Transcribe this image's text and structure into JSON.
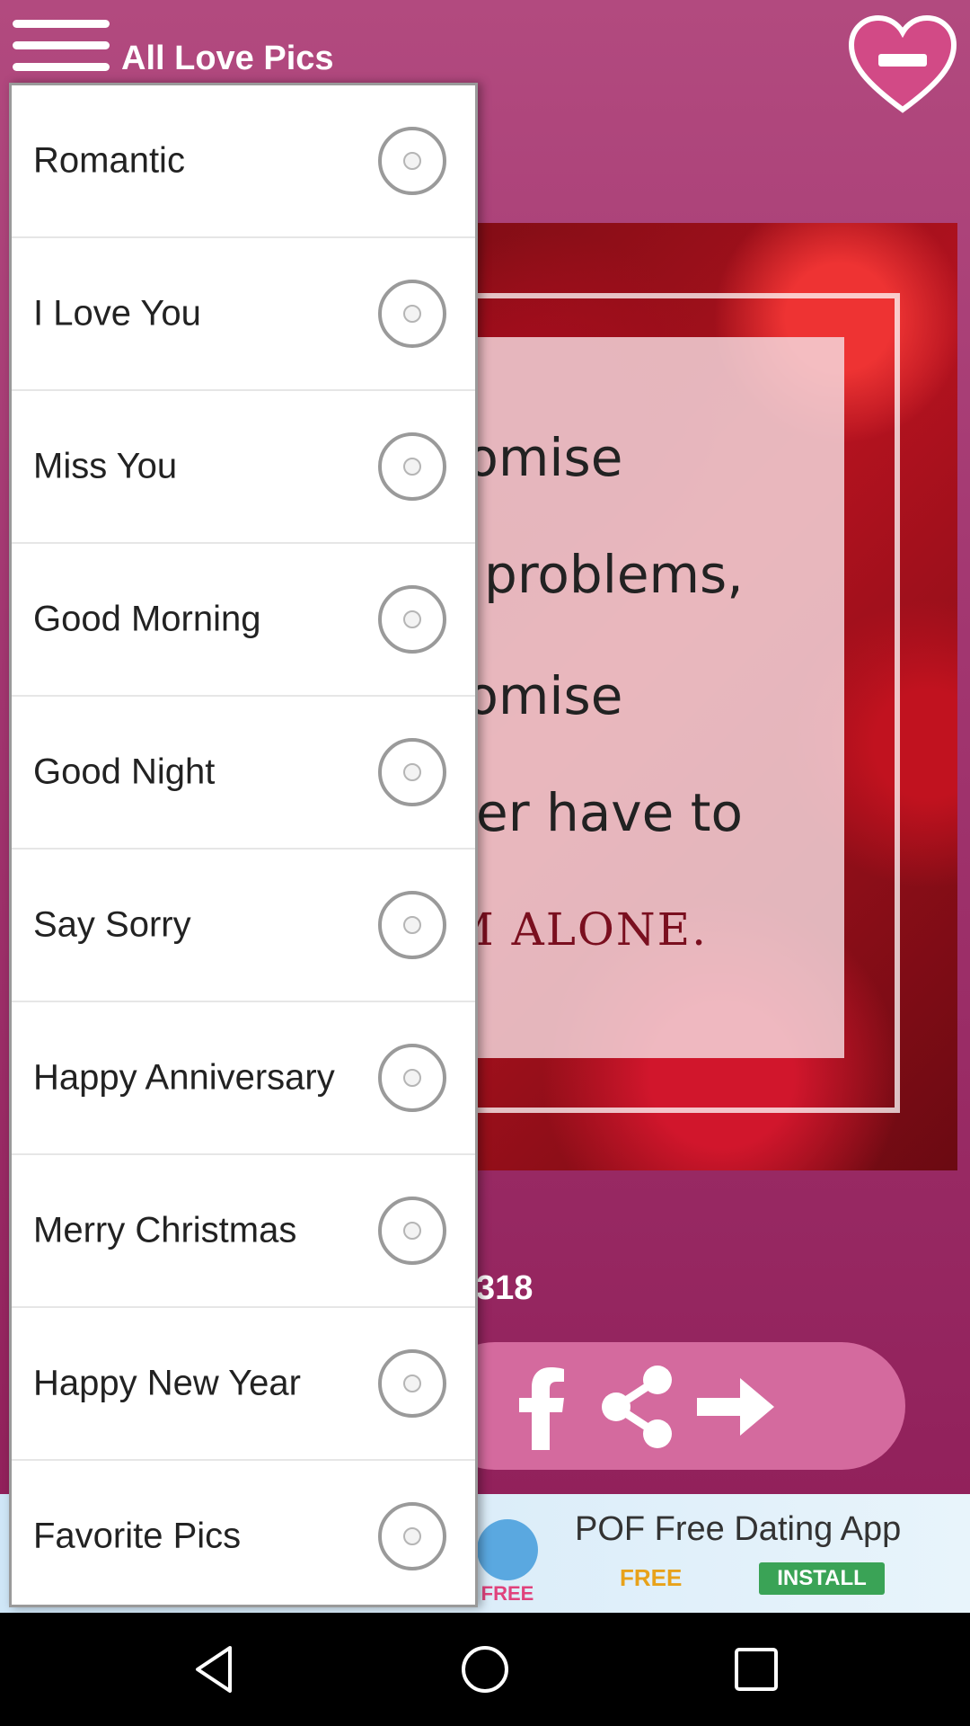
{
  "app_bar": {
    "title": "All Love Pics",
    "menu_icon": "hamburger-menu-icon",
    "favorite_icon": "heart-minus-icon"
  },
  "background": {
    "picture_text_fragments": [
      "promise",
      "ur problems,",
      "promise",
      "ever have to",
      "EM ALONE."
    ],
    "counter_fragment": "318",
    "share_actions": [
      "facebook-icon",
      "share-icon",
      "next-arrow-icon"
    ]
  },
  "drawer": {
    "items": [
      {
        "label": "Romantic"
      },
      {
        "label": "I Love You"
      },
      {
        "label": "Miss You"
      },
      {
        "label": "Good Morning"
      },
      {
        "label": "Good Night"
      },
      {
        "label": "Say Sorry"
      },
      {
        "label": "Happy Anniversary"
      },
      {
        "label": "Merry Christmas"
      },
      {
        "label": "Happy New Year"
      },
      {
        "label": "Favorite Pics"
      }
    ]
  },
  "ad": {
    "title": "POF Free Dating App",
    "free_label": "FREE",
    "install_label": "INSTALL",
    "logo_badge": "FREE"
  },
  "navbar": {
    "back_icon": "back-triangle-icon",
    "home_icon": "home-circle-icon",
    "recents_icon": "recents-square-icon"
  },
  "colors": {
    "app_bg": "#a23670",
    "share_bar": "#d46a9e",
    "install_green": "#3aa356"
  }
}
